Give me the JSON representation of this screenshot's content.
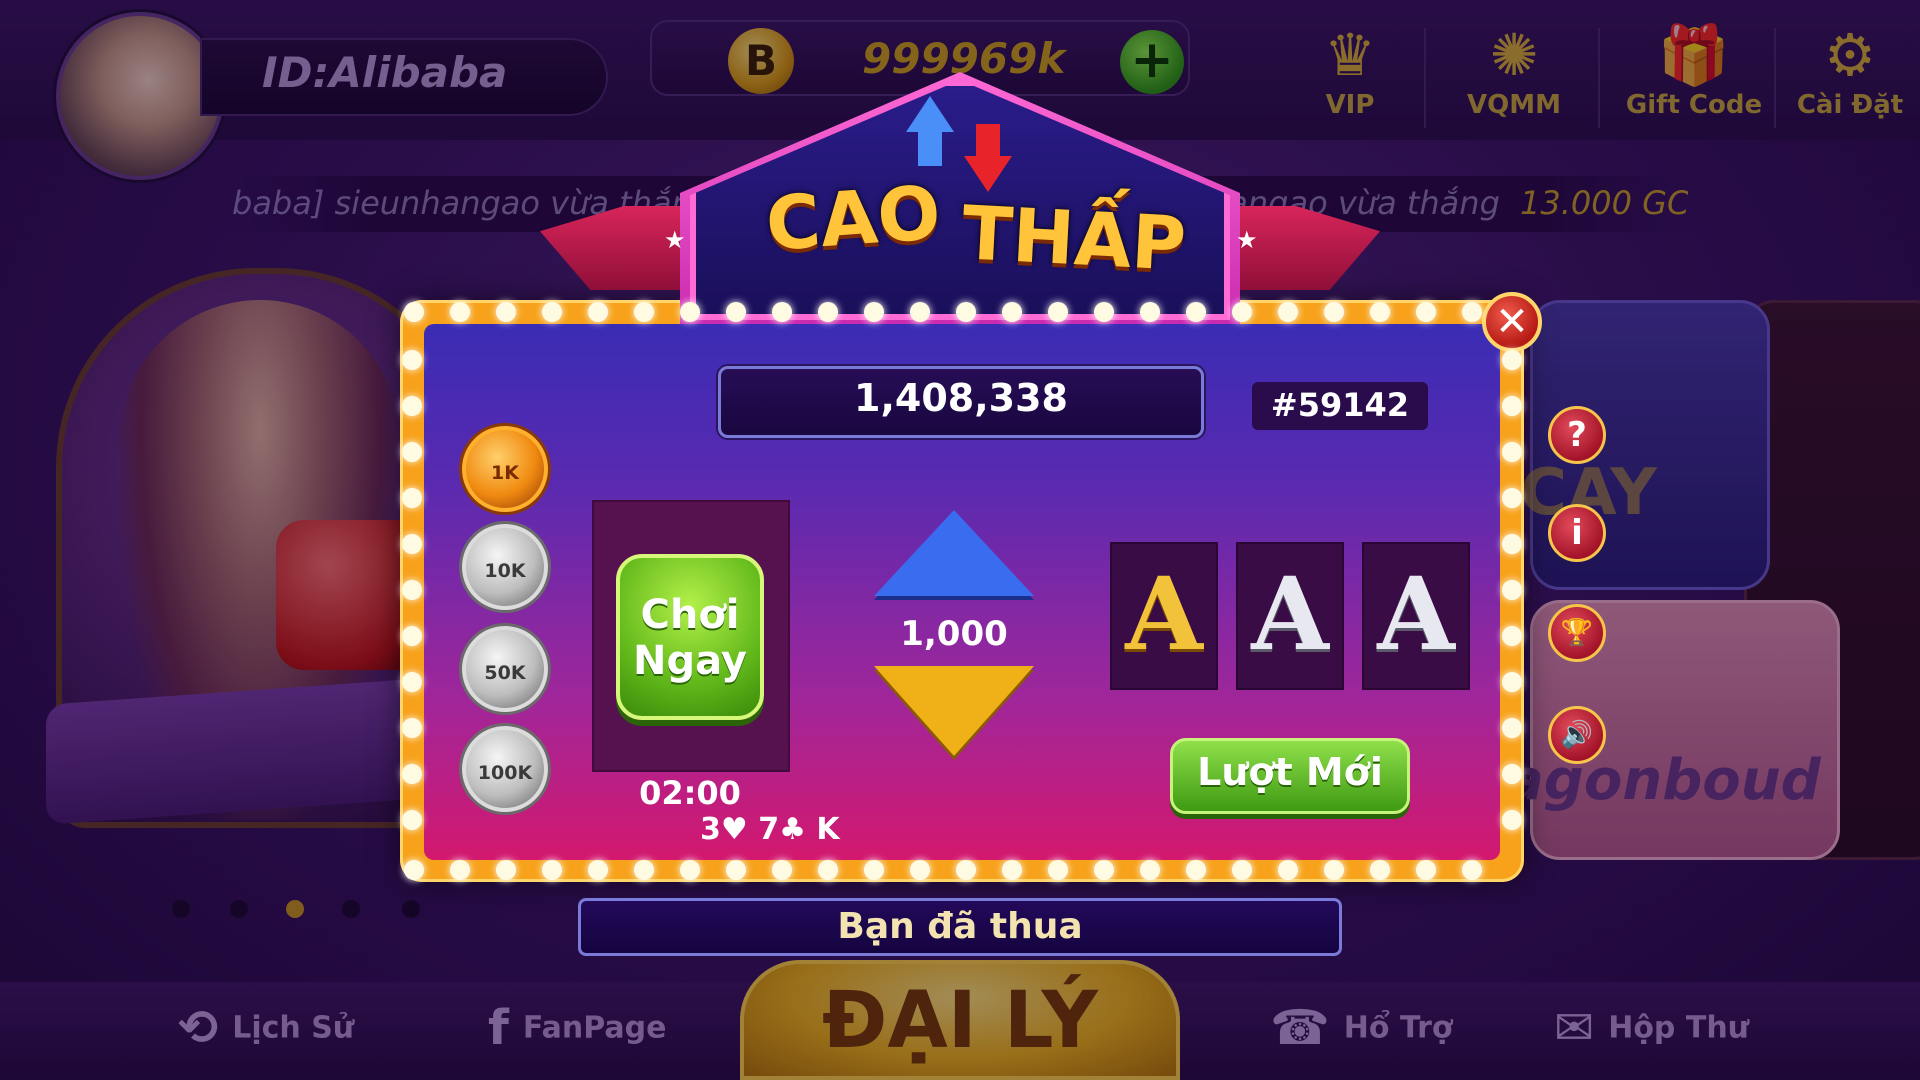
{
  "header": {
    "user_id": "ID:Alibaba",
    "coin_icon_letter": "B",
    "balance": "999969k",
    "add_symbol": "+",
    "menu": [
      {
        "label": "VIP",
        "icon": "crown-icon",
        "glyph": "♛"
      },
      {
        "label": "VQMM",
        "icon": "wheel-icon",
        "glyph": "✺"
      },
      {
        "label": "Gift Code",
        "icon": "gift-icon",
        "glyph": "🎁"
      },
      {
        "label": "Cài Đặt",
        "icon": "gear-icon",
        "glyph": "⚙"
      }
    ]
  },
  "ticker": {
    "left_text": "baba] sieunhangao vừa thắng",
    "right_text": "hangao vừa thắng",
    "right_amount": "13.000 GC"
  },
  "lobby": {
    "cay_text": "CAY",
    "right_game_text": "agonboud"
  },
  "game": {
    "title_left": "CAO",
    "title_right": "THẤP",
    "jackpot": "1,408,338",
    "session_id": "#59142",
    "chips": [
      "1K",
      "10K",
      "50K",
      "100K"
    ],
    "selected_chip": "1K",
    "play_button": {
      "line1": "Chơi",
      "line2": "Ngay"
    },
    "timer": "02:00",
    "history": "3♥ 7♣ K",
    "bet_value": "1,000",
    "cards": [
      "A",
      "A",
      "A"
    ],
    "new_round_button": "Lượt Mới",
    "side_buttons": {
      "help": "?",
      "info": "i",
      "trophy": "🏆",
      "sound": "🔊"
    },
    "close": "✕"
  },
  "result": {
    "message": "Bạn đã thua"
  },
  "footer": {
    "history_label": "Lịch Sử",
    "fanpage_label": "FanPage",
    "agent_label": "ĐẠI LÝ",
    "support_label": "Hổ Trợ",
    "inbox_label": "Hộp Thư"
  },
  "colors": {
    "accent_gold": "#f7a21a",
    "play_green": "#61b81a",
    "arrow_blue": "#3a6cf0",
    "arrow_gold": "#f0b018"
  }
}
